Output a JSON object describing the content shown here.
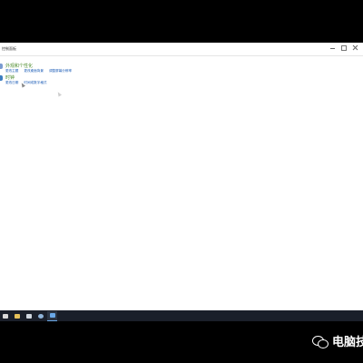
{
  "window": {
    "title": "控制面板",
    "controls": {
      "minimize_icon": "minimize-icon",
      "maximize_icon": "maximize-icon",
      "close_icon": "close-icon"
    }
  },
  "categories": [
    {
      "heading": "外观和个性化",
      "color": "#4c8b2b",
      "links": [
        "更改主题",
        "更改桌面背景",
        "调整屏幕分辨率"
      ]
    },
    {
      "heading": "时钟",
      "color": "#4c8b2b",
      "links": [
        "更改日期",
        "时间或数字格式"
      ]
    }
  ],
  "taskbar": {
    "items": [
      {
        "icon": "start-icon",
        "color": "#d9d9d9"
      },
      {
        "icon": "folder-icon",
        "color": "#e7c25a"
      },
      {
        "icon": "mail-icon",
        "color": "#cfd6df"
      },
      {
        "icon": "user-icon",
        "color": "#8fb3d9"
      },
      {
        "icon": "control-panel-icon",
        "color": "#6aa8e8"
      }
    ]
  },
  "watermark": {
    "text": "电脑技",
    "icon": "wechat-icon"
  }
}
